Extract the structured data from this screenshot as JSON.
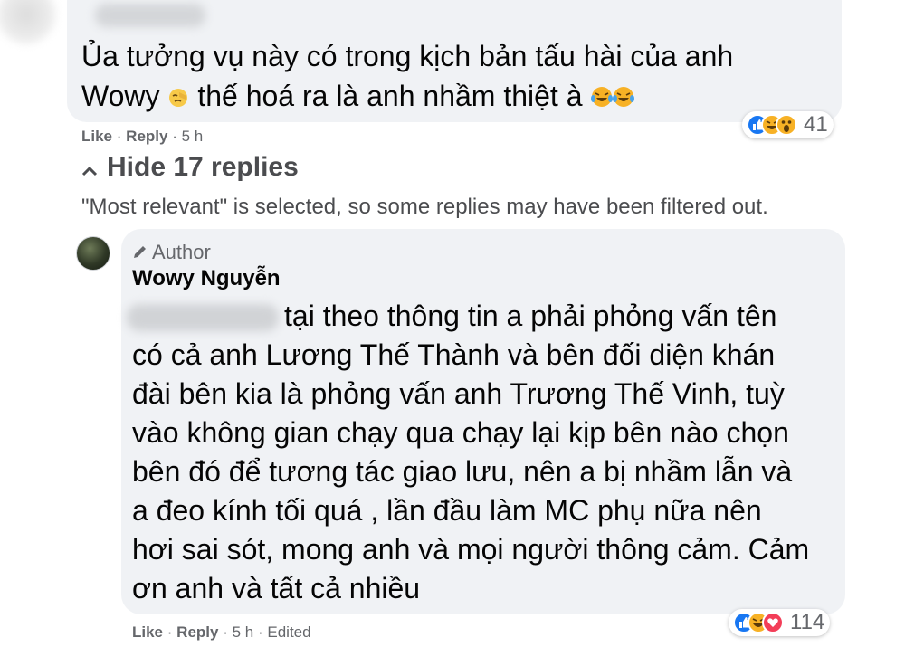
{
  "top_comment": {
    "line1": "Ủa tưởng vụ này có trong kịch bản tấu hài của anh",
    "line2_a": "Wowy",
    "line2_b": "thế hoá ra là anh nhầm thiệt à",
    "like": "Like",
    "reply": "Reply",
    "time": "5 h",
    "reaction_count": "41",
    "emoji_after_name": "facepalm-emoji",
    "emoji_end": "laughing-tears-emoji"
  },
  "replies_toggle": {
    "label": "Hide 17 replies",
    "filter_note": "\"Most relevant\" is selected, so some replies may have been filtered out."
  },
  "author_reply": {
    "badge": "Author",
    "name": "Wowy Nguyễn",
    "lines": [
      "tại theo thông tin a phải phỏng vấn tên",
      "có cả anh Lương Thế Thành và bên đối diện khán",
      "đài bên kia là phỏng vấn anh Trương Thế Vinh, tuỳ",
      "vào không gian chạy qua chạy lại kịp bên nào chọn",
      "bên đó để tương tác giao lưu, nên a bị nhầm lẫn và",
      "a đeo kính tối quá , lần đầu làm MC phụ nữa nên",
      "hơi sai sót, mong anh và mọi người thông cảm. Cảm",
      "ơn anh và tất cả nhiều"
    ],
    "like": "Like",
    "reply": "Reply",
    "time": "5 h",
    "edited": "Edited",
    "reaction_count": "114"
  },
  "colors": {
    "bubble": "#f0f2f5",
    "like_blue": "#1877f2",
    "haha_yellow": "#f7b125",
    "love_red": "#f33e58",
    "meta_gray": "#65676b"
  }
}
